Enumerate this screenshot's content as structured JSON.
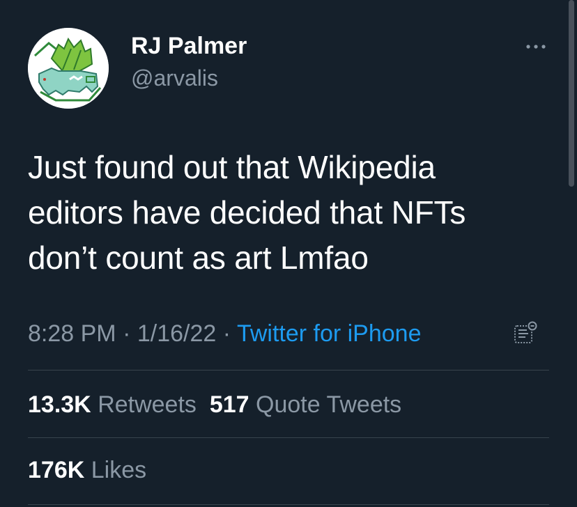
{
  "author": {
    "display_name": "RJ Palmer",
    "handle": "@arvalis",
    "avatar_icon": "bulbasaur-avatar-icon"
  },
  "tweet": {
    "text_lines": [
      "Just found out that Wikipedia",
      "editors have decided that NFTs",
      "don’t count as art Lmfao"
    ],
    "time": "8:28 PM",
    "separator": "·",
    "date": "1/16/22",
    "source": "Twitter for iPhone"
  },
  "stats": {
    "retweets_count": "13.3K",
    "retweets_label": "Retweets",
    "quotes_count": "517",
    "quotes_label": "Quote Tweets",
    "likes_count": "176K",
    "likes_label": "Likes"
  },
  "icons": {
    "more": "more-options-icon",
    "analytics": "tweet-analytics-icon"
  },
  "colors": {
    "background": "#15202b",
    "primary_text": "#ffffff",
    "secondary_text": "#8b98a5",
    "link": "#1d9bf0",
    "divider": "#38444d"
  }
}
